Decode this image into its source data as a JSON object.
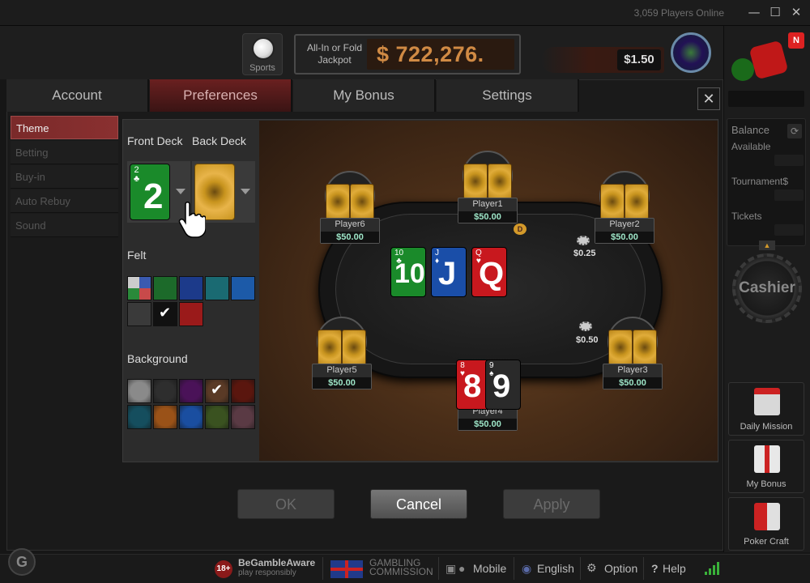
{
  "app": {
    "players_online": "3,059 Players Online"
  },
  "header": {
    "sports_label": "Sports",
    "jackpot_label": "All-In or Fold Jackpot",
    "jackpot_amount": "$ 722,276.",
    "bonus_amount": "$1.50"
  },
  "right_panel": {
    "balance_label": "Balance",
    "available_label": "Available",
    "tournament_label": "Tournament$",
    "tickets_label": "Tickets",
    "cashier_label": "Cashier",
    "daily_mission_label": "Daily Mission",
    "my_bonus_label": "My Bonus",
    "poker_craft_label": "Poker Craft",
    "notification_badge": "N"
  },
  "tabs": [
    {
      "label": "Account",
      "active": false
    },
    {
      "label": "Preferences",
      "active": true
    },
    {
      "label": "My Bonus",
      "active": false
    },
    {
      "label": "Settings",
      "active": false
    }
  ],
  "left_nav": [
    {
      "label": "Theme",
      "active": true
    },
    {
      "label": "Betting",
      "active": false
    },
    {
      "label": "Buy-in",
      "active": false
    },
    {
      "label": "Auto Rebuy",
      "active": false
    },
    {
      "label": "Sound",
      "active": false
    }
  ],
  "theme": {
    "front_deck_label": "Front Deck",
    "back_deck_label": "Back Deck",
    "front_deck_rank": "2",
    "front_deck_suit": "♣",
    "felt_label": "Felt",
    "background_label": "Background",
    "felt_colors": [
      "multi",
      "#1c6a2a",
      "#1c3a8a",
      "#1a6a72",
      "#1c5aa8",
      "#3a3a3a",
      "#111111",
      "#9a1a1a"
    ],
    "felt_selected_index": 6,
    "background_colors": [
      "#8a8a8a",
      "#2e2e2e",
      "#4a1258",
      "#5a3a26",
      "#5a160e",
      "#154e5e",
      "#9a5218",
      "#1a4ea0",
      "#3a5220",
      "#5a3a44"
    ],
    "background_selected_index": 3
  },
  "preview": {
    "community_cards": [
      {
        "rank": "10",
        "suit": "♣",
        "color": "#1a8a2a"
      },
      {
        "rank": "J",
        "suit": "♦",
        "color": "#1a4ea8"
      },
      {
        "rank": "Q",
        "suit": "♥",
        "color": "#c8181e"
      }
    ],
    "hero_cards": [
      {
        "rank": "8",
        "suit": "♥",
        "color": "#c8181e"
      },
      {
        "rank": "9",
        "suit": "♠",
        "color": "#2a2a2a"
      }
    ],
    "dealer_button": "D",
    "players": [
      {
        "name": "Player1",
        "stack": "$50.00"
      },
      {
        "name": "Player2",
        "stack": "$50.00"
      },
      {
        "name": "Player3",
        "stack": "$50.00"
      },
      {
        "name": "Player4",
        "stack": "$50.00"
      },
      {
        "name": "Player5",
        "stack": "$50.00"
      },
      {
        "name": "Player6",
        "stack": "$50.00"
      }
    ],
    "bets": [
      "$0.25",
      "$0.50"
    ]
  },
  "buttons": {
    "ok": "OK",
    "cancel": "Cancel",
    "apply": "Apply"
  },
  "footer": {
    "age": "18+",
    "begamble_title": "BeGambleAware",
    "begamble_sub": "play responsibly",
    "gambling_commission_1": "GAMBLING",
    "gambling_commission_2": "COMMISSION",
    "mobile": "Mobile",
    "language": "English",
    "option": "Option",
    "help": "Help"
  }
}
